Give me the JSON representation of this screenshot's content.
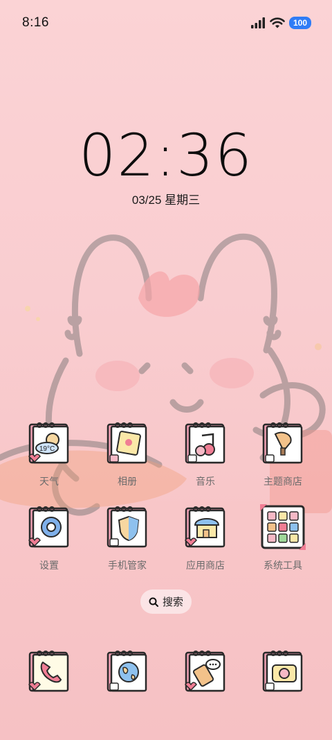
{
  "status_bar": {
    "time": "8:16",
    "battery": "100"
  },
  "clock": {
    "time": "02:36",
    "date": "03/25 星期三"
  },
  "weather_temp": "19°C",
  "apps": [
    {
      "label": "天气",
      "icon": "weather-icon"
    },
    {
      "label": "相册",
      "icon": "gallery-icon"
    },
    {
      "label": "音乐",
      "icon": "music-icon"
    },
    {
      "label": "主题商店",
      "icon": "theme-store-icon"
    },
    {
      "label": "设置",
      "icon": "settings-icon"
    },
    {
      "label": "手机管家",
      "icon": "security-icon"
    },
    {
      "label": "应用商店",
      "icon": "app-store-icon"
    },
    {
      "label": "系统工具",
      "icon": "system-tools-folder-icon"
    }
  ],
  "search": {
    "label": "搜索"
  },
  "dock": [
    {
      "icon": "phone-icon"
    },
    {
      "icon": "browser-icon"
    },
    {
      "icon": "messages-icon"
    },
    {
      "icon": "camera-icon"
    }
  ],
  "colors": {
    "background": "#f9cdd0",
    "icon_frame": "#ee9fb3",
    "battery": "#2f7cf6"
  }
}
